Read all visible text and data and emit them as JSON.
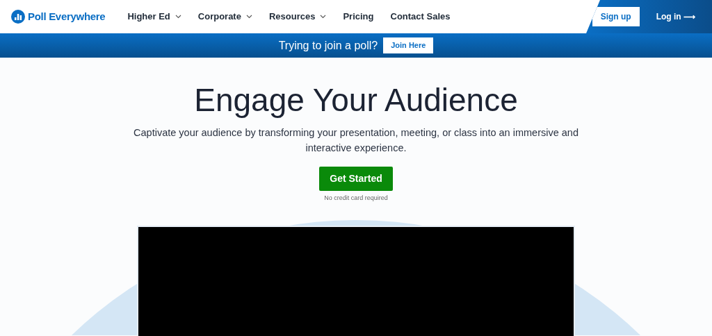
{
  "brand": {
    "name": "Poll Everywhere"
  },
  "nav": [
    {
      "label": "Higher Ed",
      "has_menu": true
    },
    {
      "label": "Corporate",
      "has_menu": true
    },
    {
      "label": "Resources",
      "has_menu": true
    },
    {
      "label": "Pricing",
      "has_menu": false
    },
    {
      "label": "Contact Sales",
      "has_menu": false
    }
  ],
  "account": {
    "signup": "Sign up",
    "login": "Log in",
    "login_arrow": "⟶"
  },
  "join_bar": {
    "text": "Trying to join a poll?",
    "button": "Join Here"
  },
  "hero": {
    "title": "Engage Your Audience",
    "subtitle": "Captivate your audience by transforming your presentation, meeting, or class into an immersive and interactive experience.",
    "cta": "Get Started",
    "note": "No credit card required"
  }
}
